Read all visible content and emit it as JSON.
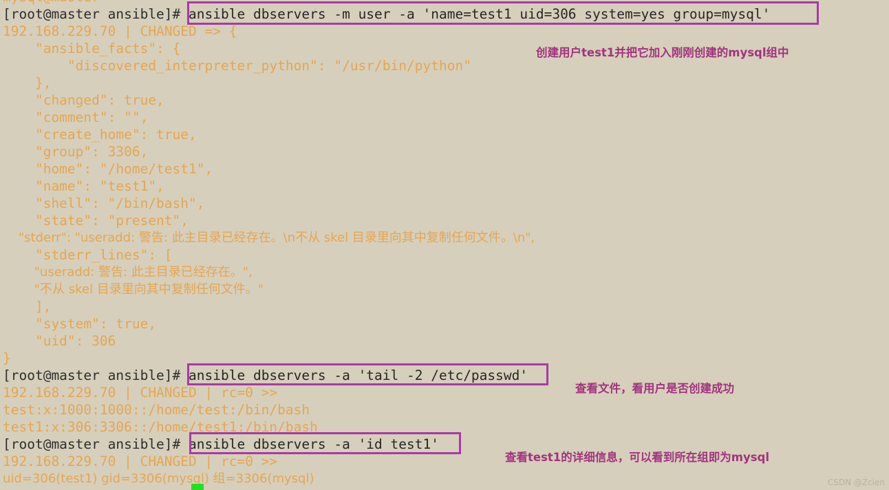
{
  "terminal": {
    "background_color": "#d6cfbb",
    "output_color": "#e5a652",
    "command_color": "#262626",
    "highlight_box_color": "#a839a8",
    "annotation_color": "#a2337f",
    "cursor_color": "#21e021",
    "clipped_top_line": "mysql@master",
    "prompt": "[root@master ansible]# ",
    "lines": [
      {
        "id": "l01",
        "type": "prompt-command",
        "prompt": "[root@master ansible]# ",
        "command": "ansible dbservers -m user -a 'name=test1 uid=306 system=yes group=mysql'"
      },
      {
        "id": "l02",
        "type": "output",
        "text": "192.168.229.70 | CHANGED => {"
      },
      {
        "id": "l03",
        "type": "output",
        "text": "    \"ansible_facts\": {"
      },
      {
        "id": "l04",
        "type": "output",
        "text": "        \"discovered_interpreter_python\": \"/usr/bin/python\""
      },
      {
        "id": "l05",
        "type": "output",
        "text": "    },"
      },
      {
        "id": "l06",
        "type": "output",
        "text": "    \"changed\": true,"
      },
      {
        "id": "l07",
        "type": "output",
        "text": "    \"comment\": \"\","
      },
      {
        "id": "l08",
        "type": "output",
        "text": "    \"create_home\": true,"
      },
      {
        "id": "l09",
        "type": "output",
        "text": "    \"group\": 3306,"
      },
      {
        "id": "l10",
        "type": "output",
        "text": "    \"home\": \"/home/test1\","
      },
      {
        "id": "l11",
        "type": "output",
        "text": "    \"name\": \"test1\","
      },
      {
        "id": "l12",
        "type": "output",
        "text": "    \"shell\": \"/bin/bash\","
      },
      {
        "id": "l13",
        "type": "output",
        "text": "    \"state\": \"present\","
      },
      {
        "id": "l14",
        "type": "output-cjk",
        "text": "    \"stderr\": \"useradd: 警告: 此主目录已经存在。\\n不从 skel 目录里向其中复制任何文件。\\n\","
      },
      {
        "id": "l15",
        "type": "output",
        "text": "    \"stderr_lines\": ["
      },
      {
        "id": "l16",
        "type": "output-cjk",
        "text": "        \"useradd: 警告: 此主目录已经存在。\","
      },
      {
        "id": "l17",
        "type": "output-cjk",
        "text": "        \"不从 skel 目录里向其中复制任何文件。\""
      },
      {
        "id": "l18",
        "type": "output",
        "text": "    ],"
      },
      {
        "id": "l19",
        "type": "output",
        "text": "    \"system\": true,"
      },
      {
        "id": "l20",
        "type": "output",
        "text": "    \"uid\": 306"
      },
      {
        "id": "l21",
        "type": "output",
        "text": "}"
      },
      {
        "id": "l22",
        "type": "prompt-command",
        "prompt": "[root@master ansible]# ",
        "command": "ansible dbservers -a 'tail -2 /etc/passwd'"
      },
      {
        "id": "l23",
        "type": "output",
        "text": "192.168.229.70 | CHANGED | rc=0 >>"
      },
      {
        "id": "l24",
        "type": "output",
        "text": "test:x:1000:1000::/home/test:/bin/bash"
      },
      {
        "id": "l25",
        "type": "output",
        "text": "test1:x:306:3306::/home/test1:/bin/bash"
      },
      {
        "id": "l26",
        "type": "prompt-command",
        "prompt": "[root@master ansible]# ",
        "command": "ansible dbservers -a 'id test1'"
      },
      {
        "id": "l27",
        "type": "output",
        "text": "192.168.229.70 | CHANGED | rc=0 >>"
      },
      {
        "id": "l28",
        "type": "output-cjk",
        "text": "uid=306(test1) gid=3306(mysql) 组=3306(mysql)"
      }
    ],
    "annotations": [
      {
        "id": "a1",
        "text": "创建用户test1并把它加入刚刚创建的mysql组中"
      },
      {
        "id": "a2",
        "text": "查看文件，看用户是否创建成功"
      },
      {
        "id": "a3",
        "text": "查看test1的详细信息，可以看到所在组即为mysql"
      }
    ],
    "watermark": "CSDN @Zcien"
  }
}
